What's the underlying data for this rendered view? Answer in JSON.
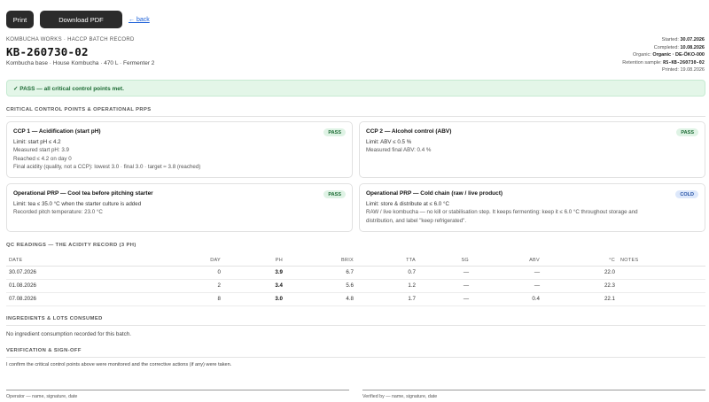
{
  "toolbar": {
    "print_label": "Print",
    "pdf_label": "Download PDF",
    "back_label": "← back"
  },
  "header": {
    "kicker": "KOMBUCHA WORKS · HACCP BATCH RECORD",
    "batch_id": "KB-260730-02",
    "subtitle": "Kombucha base · House Kombucha · 470 L · Fermenter 2"
  },
  "meta": {
    "started_label": "Started:",
    "started_value": "30.07.2026",
    "completed_label": "Completed:",
    "completed_value": "10.08.2026",
    "organic_label": "Organic:",
    "organic_value": "Organic · DE-ÖKO-000",
    "retention_label": "Retention sample:",
    "retention_value": "RS-KB-260730-02",
    "printed_label": "Printed:",
    "printed_value": "19.08.2026"
  },
  "banner": {
    "text": "✓ PASS — all critical control points met."
  },
  "ccp_section": {
    "title": "CRITICAL CONTROL POINTS & OPERATIONAL PRPS",
    "cards": [
      {
        "title": "CCP 1 — Acidification (start pH)",
        "badge": "PASS",
        "lines": [
          "Limit: start pH ≤ 4.2",
          "Measured start pH: 3.9",
          "Reached ≤ 4.2 on day 0",
          "Final acidity (quality, not a CCP): lowest 3.0 · final 3.0 · target ≈ 3.8 (reached)"
        ]
      },
      {
        "title": "CCP 2 — Alcohol control (ABV)",
        "badge": "PASS",
        "lines": [
          "Limit: ABV ≤ 0.5 %",
          "Measured final ABV: 0.4 %"
        ]
      },
      {
        "title": "Operational PRP — Cool tea before pitching starter",
        "badge": "PASS",
        "lines": [
          "Limit: tea ≤ 35.0 °C when the starter culture is added",
          "Recorded pitch temperature: 23.0 °C"
        ]
      },
      {
        "title": "Operational PRP — Cold chain (raw / live product)",
        "badge": "COLD",
        "lines": [
          "Limit: store & distribute at ≤ 6.0 °C",
          "RAW / live kombucha — no kill or stabilisation step. It keeps fermenting: keep it ≤ 6.0 °C throughout storage and",
          "distribution, and label \"keep refrigerated\"."
        ]
      }
    ]
  },
  "qc_section": {
    "title": "QC READINGS — THE ACIDITY RECORD (3 PH)",
    "columns": [
      "DATE",
      "DAY",
      "PH",
      "BRIX",
      "TTA",
      "SG",
      "ABV",
      "°C",
      "NOTES"
    ],
    "rows": [
      {
        "date": "30.07.2026",
        "day": "0",
        "ph": "3.9",
        "brix": "6.7",
        "tta": "0.7",
        "sg": "—",
        "abv": "—",
        "temp": "22.0",
        "notes": ""
      },
      {
        "date": "01.08.2026",
        "day": "2",
        "ph": "3.4",
        "brix": "5.6",
        "tta": "1.2",
        "sg": "—",
        "abv": "—",
        "temp": "22.3",
        "notes": ""
      },
      {
        "date": "07.08.2026",
        "day": "8",
        "ph": "3.0",
        "brix": "4.8",
        "tta": "1.7",
        "sg": "—",
        "abv": "0.4",
        "temp": "22.1",
        "notes": ""
      }
    ]
  },
  "ingredients_section": {
    "title": "INGREDIENTS & LOTS CONSUMED",
    "empty_text": "No ingredient consumption recorded for this batch."
  },
  "verification_section": {
    "title": "VERIFICATION & SIGN-OFF",
    "statement": "I confirm the critical control points above were monitored and the corrective actions (if any) were taken.",
    "operator_label": "Operator — name, signature, date",
    "verifier_label": "Verified by — name, signature, date"
  },
  "colors": {
    "pass_green": "#1c6b34",
    "pass_bg": "#e3f6e8",
    "cold_blue": "#2350a3",
    "button_dark": "#2b2b2b",
    "link_blue": "#1a5fd8"
  }
}
